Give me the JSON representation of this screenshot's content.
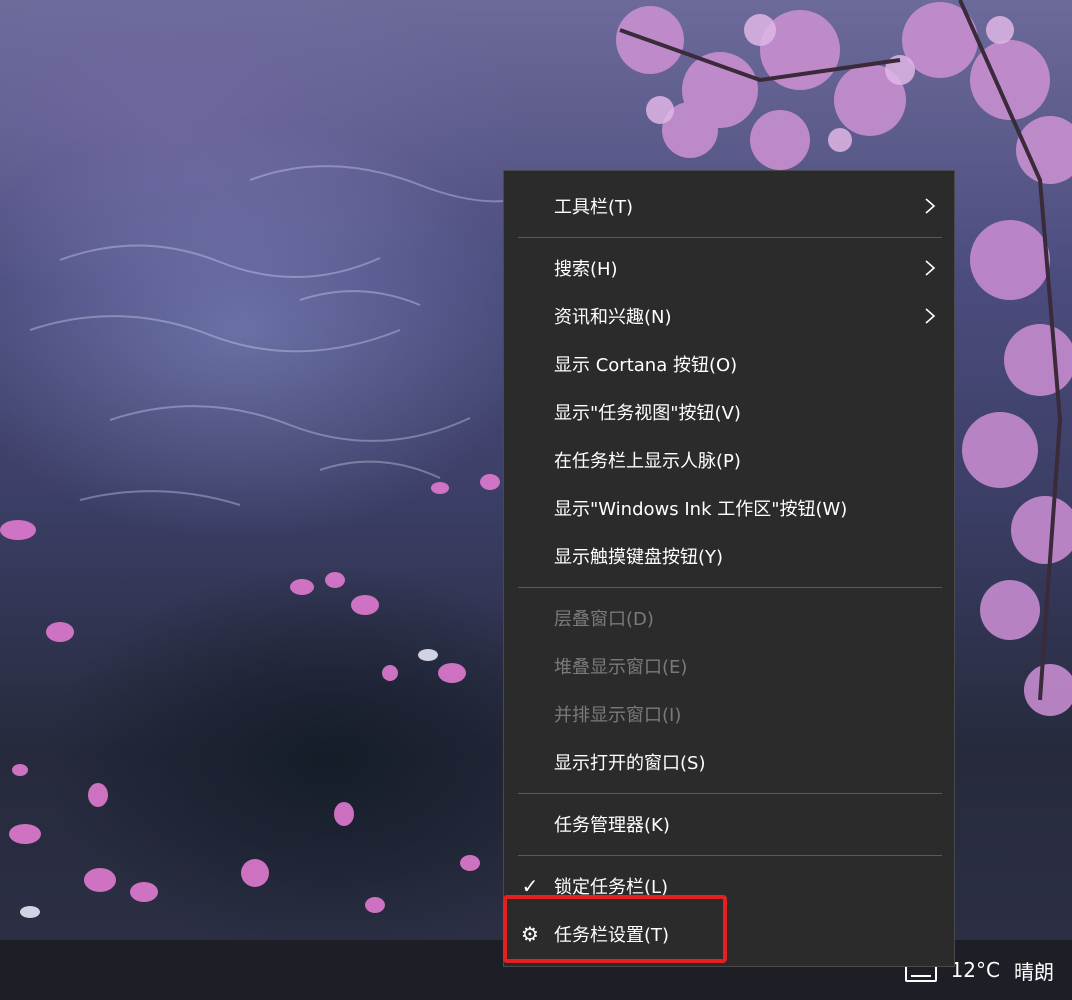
{
  "menu": {
    "groups": [
      [
        {
          "label": "工具栏(T)",
          "submenu": true,
          "enabled": true
        }
      ],
      [
        {
          "label": "搜索(H)",
          "submenu": true,
          "enabled": true
        },
        {
          "label": "资讯和兴趣(N)",
          "submenu": true,
          "enabled": true
        },
        {
          "label": "显示 Cortana 按钮(O)",
          "enabled": true
        },
        {
          "label": "显示\"任务视图\"按钮(V)",
          "enabled": true
        },
        {
          "label": "在任务栏上显示人脉(P)",
          "enabled": true
        },
        {
          "label": "显示\"Windows Ink 工作区\"按钮(W)",
          "enabled": true
        },
        {
          "label": "显示触摸键盘按钮(Y)",
          "enabled": true
        }
      ],
      [
        {
          "label": "层叠窗口(D)",
          "enabled": false
        },
        {
          "label": "堆叠显示窗口(E)",
          "enabled": false
        },
        {
          "label": "并排显示窗口(I)",
          "enabled": false
        },
        {
          "label": "显示打开的窗口(S)",
          "enabled": true
        }
      ],
      [
        {
          "label": "任务管理器(K)",
          "enabled": true
        }
      ],
      [
        {
          "label": "锁定任务栏(L)",
          "enabled": true,
          "checked": true,
          "icon": "checkmark-icon"
        },
        {
          "label": "任务栏设置(T)",
          "enabled": true,
          "icon": "gear-icon",
          "highlighted": true
        }
      ]
    ]
  },
  "taskbar": {
    "temperature": "12°C",
    "weather": "晴朗",
    "tray_icon": "news-icon"
  },
  "colors": {
    "menu_bg": "#2b2b2b",
    "highlight_border": "#e62020",
    "disabled_text": "#7a7a7a"
  }
}
